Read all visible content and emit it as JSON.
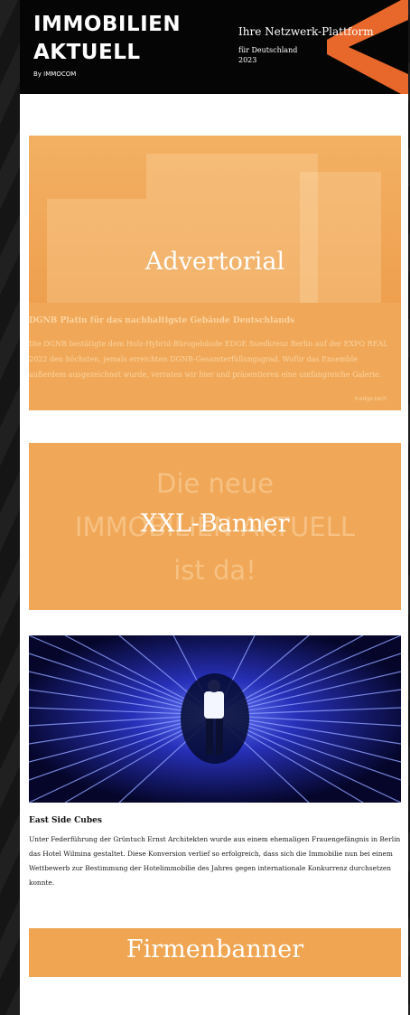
{
  "header": {
    "logo_line1": "IMMOBILIEN",
    "logo_line2": "AKTUELL",
    "logo_by": "By IMMOCOM",
    "tagline": "Ihre Netzwerk-Plattform",
    "tagline_sub1": "für Deutschland",
    "tagline_sub2": "2023"
  },
  "advertorial": {
    "label": "Advertorial",
    "title": "DGNB Platin für das nachhaltigste Gebäude Deutschlands",
    "text": "Die DGNB bestätigte dem Holz-Hybrid-Bürogebäude EDGE Suedkreuz Berlin auf der EXPO REAL 2022 den höchsten, jemals erreichten DGNB-Gesamterfüllungsgrad. Wofür das Ensemble außerdem ausgezeichnet wurde, verraten wir hier und präsentieren eine umfangreiche Galerie.",
    "credit": "©edge.tech"
  },
  "xxl": {
    "label": "XXL-Banner",
    "bg_line1": "Die neue",
    "bg_line2": "IMMOBILIEN AKTUELL",
    "bg_line3": "ist da!"
  },
  "article": {
    "title": "East Side Cubes",
    "text": "Unter Federführung der Grüntuch Ernst Architekten wurde aus einem ehemaligen Frauengefängnis in Berlin das Hotel Wilmina gestaltet. Diese Konversion verlief so erfolgreich, dass sich die Immobilie nun bei einem Wettbewerb zur Bestimmung der Hotelimmobilie des Jahres gegen internationale Konkurrenz durchsetzen konnte."
  },
  "firmen": {
    "label": "Firmenbanner"
  },
  "colors": {
    "brand_orange": "#e8672a",
    "ad_orange": "#f0a858",
    "header_bg": "#050505"
  }
}
